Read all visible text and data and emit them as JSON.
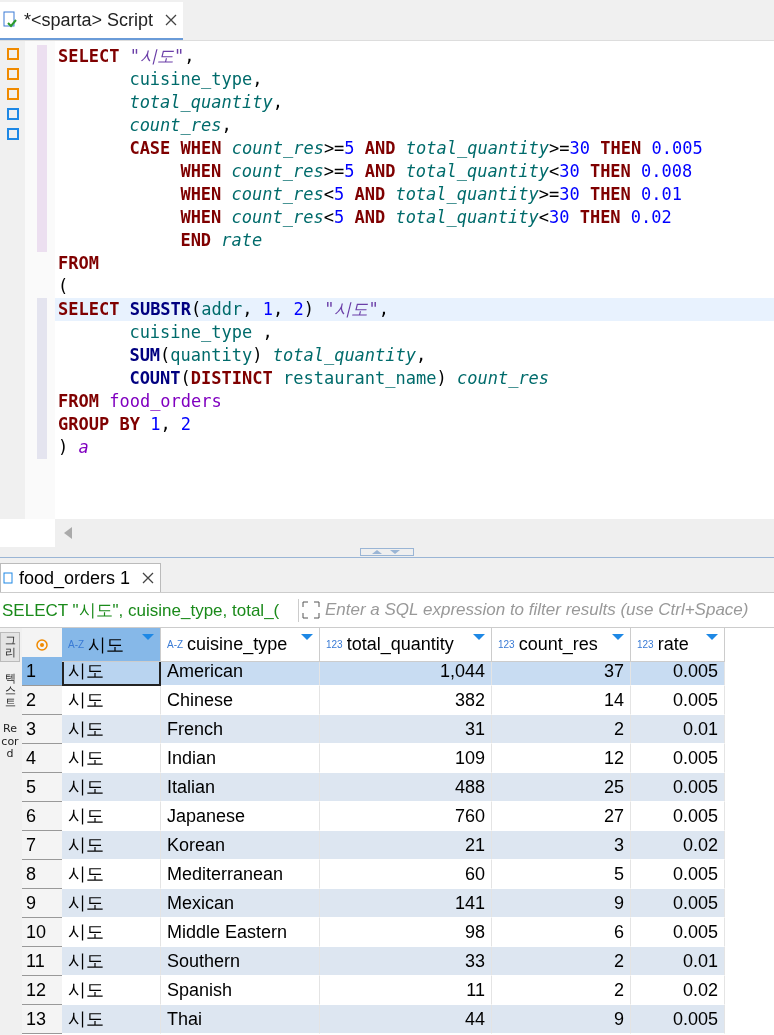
{
  "editor_tab": {
    "title": "*<sparta> Script",
    "modified": true
  },
  "code_lines": [
    {
      "kind": "top",
      "current": false,
      "tokens": [
        {
          "kind": "keyword",
          "text": "SELECT "
        },
        {
          "kind": "string",
          "text": "\"시도\""
        },
        {
          "kind": "plain",
          "text": ","
        }
      ]
    },
    {
      "kind": "item",
      "current": false,
      "tokens": [
        {
          "kind": "column",
          "text": "cuisine_type"
        },
        {
          "kind": "plain",
          "text": ","
        }
      ]
    },
    {
      "kind": "item",
      "current": false,
      "tokens": [
        {
          "kind": "alias",
          "text": "total_quantity"
        },
        {
          "kind": "plain",
          "text": ","
        }
      ]
    },
    {
      "kind": "item",
      "current": false,
      "tokens": [
        {
          "kind": "alias",
          "text": "count_res"
        },
        {
          "kind": "plain",
          "text": ","
        }
      ]
    },
    {
      "kind": "item",
      "current": false,
      "tokens": [
        {
          "kind": "keyword",
          "text": "CASE WHEN "
        },
        {
          "kind": "alias",
          "text": "count_res"
        },
        {
          "kind": "plain",
          "text": ">="
        },
        {
          "kind": "number",
          "text": "5 "
        },
        {
          "kind": "keyword",
          "text": "AND "
        },
        {
          "kind": "alias",
          "text": "total_quantity"
        },
        {
          "kind": "plain",
          "text": ">="
        },
        {
          "kind": "number",
          "text": "30 "
        },
        {
          "kind": "keyword",
          "text": "THEN "
        },
        {
          "kind": "number",
          "text": "0.005"
        }
      ]
    },
    {
      "kind": "when",
      "current": false,
      "tokens": [
        {
          "kind": "keyword",
          "text": "WHEN "
        },
        {
          "kind": "alias",
          "text": "count_res"
        },
        {
          "kind": "plain",
          "text": ">="
        },
        {
          "kind": "number",
          "text": "5 "
        },
        {
          "kind": "keyword",
          "text": "AND "
        },
        {
          "kind": "alias",
          "text": "total_quantity"
        },
        {
          "kind": "plain",
          "text": "<"
        },
        {
          "kind": "number",
          "text": "30 "
        },
        {
          "kind": "keyword",
          "text": "THEN "
        },
        {
          "kind": "number",
          "text": "0.008"
        }
      ]
    },
    {
      "kind": "when",
      "current": false,
      "tokens": [
        {
          "kind": "keyword",
          "text": "WHEN "
        },
        {
          "kind": "alias",
          "text": "count_res"
        },
        {
          "kind": "plain",
          "text": "<"
        },
        {
          "kind": "number",
          "text": "5 "
        },
        {
          "kind": "keyword",
          "text": "AND "
        },
        {
          "kind": "alias",
          "text": "total_quantity"
        },
        {
          "kind": "plain",
          "text": ">="
        },
        {
          "kind": "number",
          "text": "30 "
        },
        {
          "kind": "keyword",
          "text": "THEN "
        },
        {
          "kind": "number",
          "text": "0.01"
        }
      ]
    },
    {
      "kind": "when",
      "current": false,
      "tokens": [
        {
          "kind": "keyword",
          "text": "WHEN "
        },
        {
          "kind": "alias",
          "text": "count_res"
        },
        {
          "kind": "plain",
          "text": "<"
        },
        {
          "kind": "number",
          "text": "5 "
        },
        {
          "kind": "keyword",
          "text": "AND "
        },
        {
          "kind": "alias",
          "text": "total_quantity"
        },
        {
          "kind": "plain",
          "text": "<"
        },
        {
          "kind": "number",
          "text": "30 "
        },
        {
          "kind": "keyword",
          "text": "THEN "
        },
        {
          "kind": "number",
          "text": "0.02"
        }
      ]
    },
    {
      "kind": "when",
      "current": false,
      "tokens": [
        {
          "kind": "keyword",
          "text": "END "
        },
        {
          "kind": "alias",
          "text": "rate"
        }
      ]
    },
    {
      "kind": "top",
      "current": false,
      "tokens": [
        {
          "kind": "keyword",
          "text": "FROM"
        }
      ]
    },
    {
      "kind": "top",
      "current": false,
      "tokens": [
        {
          "kind": "plain",
          "text": "("
        }
      ]
    },
    {
      "kind": "top",
      "current": true,
      "tokens": [
        {
          "kind": "keyword",
          "text": "SELECT "
        },
        {
          "kind": "function",
          "text": "SUBSTR"
        },
        {
          "kind": "plain",
          "text": "("
        },
        {
          "kind": "column",
          "text": "addr"
        },
        {
          "kind": "plain",
          "text": ", "
        },
        {
          "kind": "number",
          "text": "1"
        },
        {
          "kind": "plain",
          "text": ", "
        },
        {
          "kind": "number",
          "text": "2"
        },
        {
          "kind": "plain",
          "text": ") "
        },
        {
          "kind": "string",
          "text": "\"시도\""
        },
        {
          "kind": "plain",
          "text": ","
        }
      ]
    },
    {
      "kind": "item",
      "current": false,
      "tokens": [
        {
          "kind": "column",
          "text": "cuisine_type "
        },
        {
          "kind": "plain",
          "text": ","
        }
      ]
    },
    {
      "kind": "item",
      "current": false,
      "tokens": [
        {
          "kind": "function",
          "text": "SUM"
        },
        {
          "kind": "plain",
          "text": "("
        },
        {
          "kind": "column",
          "text": "quantity"
        },
        {
          "kind": "plain",
          "text": ") "
        },
        {
          "kind": "alias",
          "text": "total_quantity"
        },
        {
          "kind": "plain",
          "text": ","
        }
      ]
    },
    {
      "kind": "item",
      "current": false,
      "tokens": [
        {
          "kind": "function",
          "text": "COUNT"
        },
        {
          "kind": "plain",
          "text": "("
        },
        {
          "kind": "keyword",
          "text": "DISTINCT "
        },
        {
          "kind": "column",
          "text": "restaurant_name"
        },
        {
          "kind": "plain",
          "text": ") "
        },
        {
          "kind": "alias",
          "text": "count_res"
        }
      ]
    },
    {
      "kind": "top",
      "current": false,
      "tokens": [
        {
          "kind": "keyword",
          "text": "FROM "
        },
        {
          "kind": "table",
          "text": "food_orders"
        }
      ]
    },
    {
      "kind": "top",
      "current": false,
      "tokens": [
        {
          "kind": "keyword",
          "text": "GROUP BY "
        },
        {
          "kind": "number",
          "text": "1"
        },
        {
          "kind": "plain",
          "text": ", "
        },
        {
          "kind": "number",
          "text": "2"
        }
      ]
    },
    {
      "kind": "top",
      "current": false,
      "tokens": [
        {
          "kind": "plain",
          "text": ") "
        },
        {
          "kind": "table_alias",
          "text": "a"
        }
      ]
    }
  ],
  "results_tab": {
    "title": "food_orders 1"
  },
  "filter": {
    "query": "SELECT \"시도\", cuisine_type, total_(",
    "placeholder": "Enter a SQL expression to filter results (use Ctrl+Space)"
  },
  "side_tabs": [
    {
      "label": "그리",
      "selected": true
    },
    {
      "label": "텍스트",
      "selected": false
    },
    {
      "label": "Record",
      "selected": false
    }
  ],
  "table": {
    "columns": [
      {
        "name": "시도",
        "type": "A-Z",
        "selected": true
      },
      {
        "name": "cuisine_type",
        "type": "A-Z",
        "selected": false
      },
      {
        "name": "total_quantity",
        "type": "123",
        "selected": false
      },
      {
        "name": "count_res",
        "type": "123",
        "selected": false
      },
      {
        "name": "rate",
        "type": "123",
        "selected": false
      }
    ],
    "rows": [
      {
        "n": "1",
        "cells": [
          "시도",
          "American",
          "1,044",
          "37",
          "0.005"
        ],
        "selected": true
      },
      {
        "n": "2",
        "cells": [
          "시도",
          "Chinese",
          "382",
          "14",
          "0.005"
        ],
        "selected": false
      },
      {
        "n": "3",
        "cells": [
          "시도",
          "French",
          "31",
          "2",
          "0.01"
        ],
        "selected": false
      },
      {
        "n": "4",
        "cells": [
          "시도",
          "Indian",
          "109",
          "12",
          "0.005"
        ],
        "selected": false
      },
      {
        "n": "5",
        "cells": [
          "시도",
          "Italian",
          "488",
          "25",
          "0.005"
        ],
        "selected": false
      },
      {
        "n": "6",
        "cells": [
          "시도",
          "Japanese",
          "760",
          "27",
          "0.005"
        ],
        "selected": false
      },
      {
        "n": "7",
        "cells": [
          "시도",
          "Korean",
          "21",
          "3",
          "0.02"
        ],
        "selected": false
      },
      {
        "n": "8",
        "cells": [
          "시도",
          "Mediterranean",
          "60",
          "5",
          "0.005"
        ],
        "selected": false
      },
      {
        "n": "9",
        "cells": [
          "시도",
          "Mexican",
          "141",
          "9",
          "0.005"
        ],
        "selected": false
      },
      {
        "n": "10",
        "cells": [
          "시도",
          "Middle Eastern",
          "98",
          "6",
          "0.005"
        ],
        "selected": false
      },
      {
        "n": "11",
        "cells": [
          "시도",
          "Southern",
          "33",
          "2",
          "0.01"
        ],
        "selected": false
      },
      {
        "n": "12",
        "cells": [
          "시도",
          "Spanish",
          "11",
          "2",
          "0.02"
        ],
        "selected": false
      },
      {
        "n": "13",
        "cells": [
          "시도",
          "Thai",
          "44",
          "9",
          "0.005"
        ],
        "selected": false
      }
    ]
  }
}
